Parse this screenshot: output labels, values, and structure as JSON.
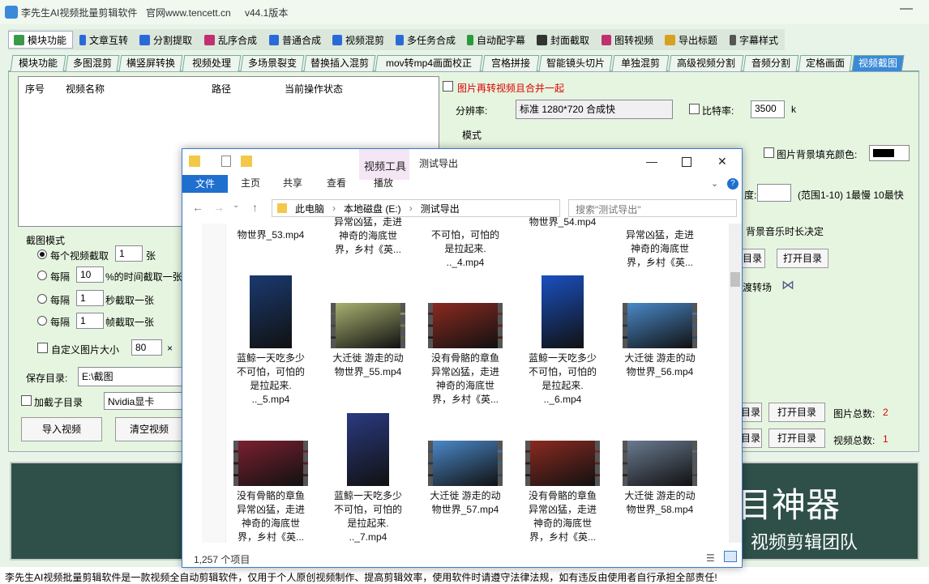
{
  "app": {
    "title": "李先生AI视频批量剪辑软件",
    "website": "官网www.tencett.cn",
    "version": "v44.1版本",
    "minimize": "—"
  },
  "modules": [
    {
      "label": "模块功能",
      "icon": "modules-icon",
      "color": "#3a9a4a",
      "active": true
    },
    {
      "label": "文章互转",
      "icon": "text-icon",
      "color": "#2a6ad8"
    },
    {
      "label": "分割提取",
      "icon": "split-icon",
      "color": "#2a6ad8"
    },
    {
      "label": "乱序合成",
      "icon": "shuffle-icon",
      "color": "#c03070"
    },
    {
      "label": "普通合成",
      "icon": "merge-icon",
      "color": "#2a6ad8"
    },
    {
      "label": "视频混剪",
      "icon": "mix-icon",
      "color": "#2a6ad8"
    },
    {
      "label": "多任务合成",
      "icon": "multitask-icon",
      "color": "#2a6ad8"
    },
    {
      "label": "自动配字幕",
      "icon": "subtitle-auto-icon",
      "color": "#2a9a3a"
    },
    {
      "label": "封面截取",
      "icon": "cover-icon",
      "color": "#333"
    },
    {
      "label": "图转视频",
      "icon": "image-video-icon",
      "color": "#c03070"
    },
    {
      "label": "导出标题",
      "icon": "export-title-icon",
      "color": "#d8a020"
    },
    {
      "label": "字幕样式",
      "icon": "subtitle-style-icon",
      "color": "#555"
    }
  ],
  "tabs": [
    "模块功能",
    "多图混剪",
    "横竖屏转换",
    "视频处理",
    "多场景裂变",
    "替换插入混剪",
    "mov转mp4画面校正",
    "宫格拼接",
    "智能镜头切片",
    "单独混剪",
    "高级视频分割",
    "音频分割",
    "定格画面",
    "视频截图"
  ],
  "list_columns": [
    "序号",
    "视频名称",
    "路径",
    "当前操作状态"
  ],
  "screenshot_mode": {
    "title": "截图模式",
    "options": [
      {
        "label": "每个视频截取",
        "value": "1",
        "unit": "张",
        "selected": true
      },
      {
        "label": "每隔",
        "value": "10",
        "unit": "%的时间截取一张"
      },
      {
        "label": "每隔",
        "value": "1",
        "unit": "秒截取一张"
      },
      {
        "label": "每隔",
        "value": "1",
        "unit": "帧截取一张"
      }
    ],
    "custom_size_label": "自定义图片大小",
    "custom_width": "80",
    "x_sign": "×"
  },
  "save": {
    "label": "保存目录:",
    "value": "E:\\截图",
    "subdir_label": "加截子目录",
    "gpu": "Nvidia显卡"
  },
  "buttons": {
    "import": "导入视频",
    "clear": "清空视频",
    "open_dir": "打开目录",
    "open_dir2": "打开目录",
    "open_dir3": "打开目录",
    "dir_partial": "目录",
    "dir_partial2": "目录",
    "dir_partial3": "目录"
  },
  "right": {
    "merge_label": "图片再转视频且合并一起",
    "resolution_label": "分辨率:",
    "resolution": "标准 1280*720 合成快",
    "bitrate_label": "比特率:",
    "bitrate": "3500",
    "bitrate_unit": "k",
    "mode_label": "模式",
    "bg_fill_label": "图片背景填充颜色:",
    "speed_label": "度:",
    "speed_range": "(范围1-10) 1最慢 10最快",
    "music_label": "背景音乐时长决定",
    "transition_label": "渡转场",
    "image_total_label": "图片总数:",
    "image_total": "2",
    "video_total_label": "视频总数:",
    "video_total": "1"
  },
  "banner": {
    "line1": "目神器",
    "line2": "视频剪辑团队"
  },
  "footer": "李先生AI视频批量剪辑软件是一款视频全自动剪辑软件，仅用于个人原创视频制作、提高剪辑效率，使用软件时请遵守法律法规，如有违反由使用者自行承担全部责任!",
  "explorer": {
    "context_tab": "视频工具",
    "title": "测试导出",
    "ribbon": {
      "file": "文件",
      "home": "主页",
      "share": "共享",
      "view": "查看",
      "play": "播放"
    },
    "breadcrumb": [
      "此电脑",
      "本地磁盘 (E:)",
      "测试导出"
    ],
    "search_placeholder": "搜索\"测试导出\"",
    "status": "1,257 个项目",
    "top_captions": [
      "物世界_53.mp4",
      "异常凶猛，走进\n神奇的海底世\n界，乡村《英...",
      "不可怕，可怕的\n是拉起来.\n.._4.mp4",
      "物世界_54.mp4",
      "异常凶猛，走进\n神奇的海底世\n界，乡村《英..."
    ],
    "files": [
      {
        "caption": "蓝鲸一天吃多少\n不可怕，可怕的\n是拉起来.\n.._5.mp4",
        "kind": "portrait",
        "color": "#1a3a70"
      },
      {
        "caption": "大迁徙 游走的动\n物世界_55.mp4",
        "kind": "landscape",
        "color": "#a8b070"
      },
      {
        "caption": "没有骨骼的章鱼\n异常凶猛，走进\n神奇的海底世\n界，乡村《英...",
        "kind": "landscape",
        "color": "#8a2a20"
      },
      {
        "caption": "蓝鲸一天吃多少\n不可怕，可怕的\n是拉起来.\n.._6.mp4",
        "kind": "portrait",
        "color": "#1a50c0"
      },
      {
        "caption": "大迁徙 游走的动\n物世界_56.mp4",
        "kind": "landscape",
        "color": "#4a88c8"
      },
      {
        "caption": "没有骨骼的章鱼\n异常凶猛，走进\n神奇的海底世\n界，乡村《英...",
        "kind": "landscape",
        "color": "#7a2030"
      },
      {
        "caption": "蓝鲸一天吃多少\n不可怕，可怕的\n是拉起来.\n.._7.mp4",
        "kind": "portrait",
        "color": "#2a3a80"
      },
      {
        "caption": "大迁徙 游走的动\n物世界_57.mp4",
        "kind": "landscape",
        "color": "#4a88c8"
      },
      {
        "caption": "没有骨骼的章鱼\n异常凶猛，走进\n神奇的海底世\n界，乡村《英...",
        "kind": "landscape",
        "color": "#8a2a20"
      },
      {
        "caption": "大迁徙 游走的动\n物世界_58.mp4",
        "kind": "landscape",
        "color": "#6a7a90"
      }
    ]
  }
}
